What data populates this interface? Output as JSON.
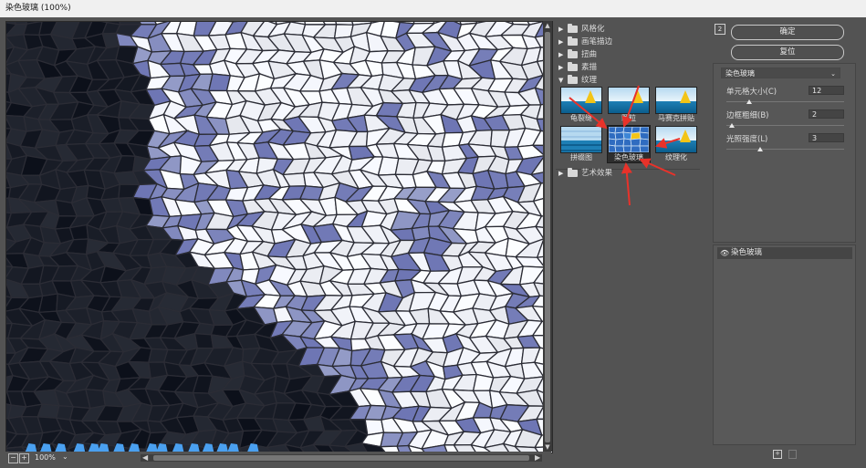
{
  "window": {
    "title": "染色玻璃 (100%)"
  },
  "preview": {
    "zoom_label": "100%"
  },
  "gallery": {
    "folders": [
      {
        "label": "风格化",
        "expanded": false
      },
      {
        "label": "画笔描边",
        "expanded": false
      },
      {
        "label": "扭曲",
        "expanded": false
      },
      {
        "label": "素描",
        "expanded": false
      },
      {
        "label": "纹理",
        "expanded": true
      },
      {
        "label": "艺术效果",
        "expanded": false
      }
    ],
    "texture_filters": [
      {
        "label": "龟裂缝"
      },
      {
        "label": "颗粒"
      },
      {
        "label": "马赛克拼贴"
      },
      {
        "label": "拼缀图"
      },
      {
        "label": "染色玻璃",
        "selected": true
      },
      {
        "label": "纹理化"
      }
    ]
  },
  "panel": {
    "number_badge": "2",
    "ok_label": "确定",
    "reset_label": "复位",
    "filter_select": "染色玻璃",
    "params": [
      {
        "label": "单元格大小(C)",
        "value": "12",
        "level": 0.2
      },
      {
        "label": "边框粗细(B)",
        "value": "2",
        "level": 0.05
      },
      {
        "label": "光照强度(L)",
        "value": "3",
        "level": 0.3
      }
    ],
    "layer_name": "染色玻璃"
  },
  "colors": {
    "annotation_arrow": "#e8322a",
    "accent_glass": "#8e96c4"
  }
}
